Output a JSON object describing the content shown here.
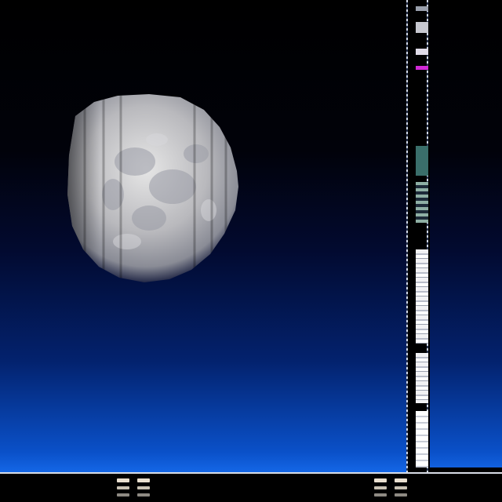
{
  "desktop": {
    "wallpaper": "moon-over-blue-horizon",
    "colors": {
      "sky_top": "#000000",
      "sky_bottom": "#1466e6",
      "panel_edge": "#cfd7e6",
      "accent": "#d12ad6"
    }
  },
  "side_panel": {
    "thumbnails": [
      {
        "name": "thumb-header"
      },
      {
        "name": "thumb-accent"
      },
      {
        "name": "thumb-app-1"
      },
      {
        "name": "thumb-app-2"
      },
      {
        "name": "thumb-document"
      },
      {
        "name": "thumb-list"
      },
      {
        "name": "thumb-footer"
      }
    ]
  },
  "taskbar": {
    "items": [
      {
        "icon": "app-icon",
        "label": ""
      },
      {
        "icon": "app-icon",
        "label": ""
      },
      {
        "icon": "app-icon",
        "label": ""
      },
      {
        "icon": "app-icon",
        "label": ""
      }
    ]
  }
}
